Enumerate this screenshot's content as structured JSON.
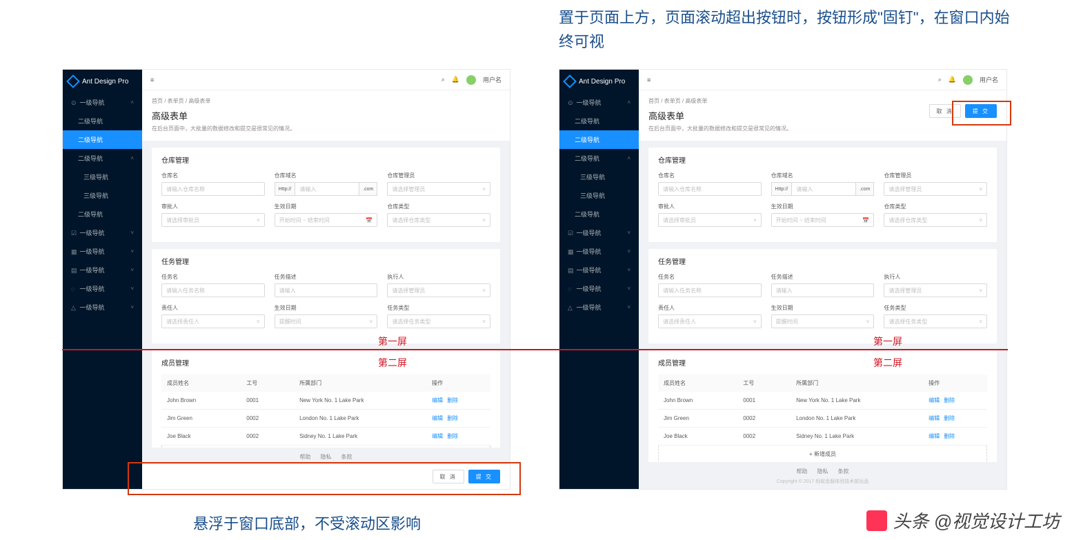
{
  "captions": {
    "top": "置于页面上方，页面滚动超出按钮时，按钮形成\"固钉\"，在窗口内始终可视",
    "bottom": "悬浮于窗口底部，不受滚动区影响",
    "screen1": "第一屏",
    "screen2": "第二屏"
  },
  "watermark": "头条 @视觉设计工坊",
  "app": {
    "brand": "Ant Design Pro",
    "username": "用户名",
    "menu_trigger": "≡"
  },
  "sidebar": {
    "items": [
      {
        "label": "一级导航",
        "icon": "⊙",
        "arrow": "˄",
        "level": 0
      },
      {
        "label": "二级导航",
        "level": 1
      },
      {
        "label": "二级导航",
        "level": 1,
        "sel": true
      },
      {
        "label": "二级导航",
        "arrow": "˄",
        "level": 1
      },
      {
        "label": "三级导航",
        "level": 2
      },
      {
        "label": "三级导航",
        "level": 2
      },
      {
        "label": "二级导航",
        "level": 1
      },
      {
        "label": "一级导航",
        "icon": "☑",
        "arrow": "˅",
        "level": 0
      },
      {
        "label": "一级导航",
        "icon": "▦",
        "arrow": "˅",
        "level": 0
      },
      {
        "label": "一级导航",
        "icon": "▤",
        "arrow": "˅",
        "level": 0
      },
      {
        "label": "一级导航",
        "icon": "◌",
        "arrow": "˅",
        "level": 0
      },
      {
        "label": "一级导航",
        "icon": "△",
        "arrow": "˅",
        "level": 0
      }
    ]
  },
  "breadcrumb": "首页 / 表单页 / 高级表单",
  "page_title": "高级表单",
  "page_desc": "在后台页面中，大批量的数据修改和提交是很常见的情况。",
  "card_warehouse": {
    "title": "仓库管理",
    "fields": {
      "name_label": "仓库名",
      "name_ph": "请输入仓库名称",
      "domain_label": "仓库域名",
      "domain_pre": "Http://",
      "domain_ph": "请输入",
      "domain_suf": ".com",
      "admin_label": "仓库管理员",
      "admin_ph": "请选择管理员",
      "approver_label": "审批人",
      "approver_ph": "请选择审批员",
      "date_label": "生效日期",
      "date_ph": "开始时间 ~ 结束时间",
      "type_label": "仓库类型",
      "type_ph": "请选择仓库类型"
    }
  },
  "card_task": {
    "title": "任务管理",
    "fields": {
      "name_label": "任务名",
      "name_ph": "请输入任务名称",
      "desc_label": "任务描述",
      "desc_ph": "请输入",
      "exec_label": "执行人",
      "exec_ph": "请选择管理员",
      "resp_label": "责任人",
      "resp_ph": "请选择责任人",
      "date_label": "生效日期",
      "date_ph": "提醒时间",
      "type_label": "任务类型",
      "type_ph": "请选择任务类型"
    }
  },
  "card_members": {
    "title": "成员管理",
    "cols": {
      "name": "成员姓名",
      "no": "工号",
      "dept": "所属部门",
      "ops": "操作"
    },
    "rows": [
      {
        "name": "John Brown",
        "no": "0001",
        "dept": "New York No. 1 Lake Park"
      },
      {
        "name": "Jim Green",
        "no": "0002",
        "dept": "London No. 1 Lake Park"
      },
      {
        "name": "Joe Black",
        "no": "0002",
        "dept": "Sidney No. 1 Lake Park"
      }
    ],
    "edit": "编辑",
    "del": "删除",
    "add": "+ 新增成员"
  },
  "footer": {
    "links": {
      "help": "帮助",
      "privacy": "隐私",
      "terms": "条款"
    },
    "copyright": "Copyright © 2017 蚂蚁金服体验技术部出品",
    "cancel": "取 消",
    "submit": "提 交"
  }
}
